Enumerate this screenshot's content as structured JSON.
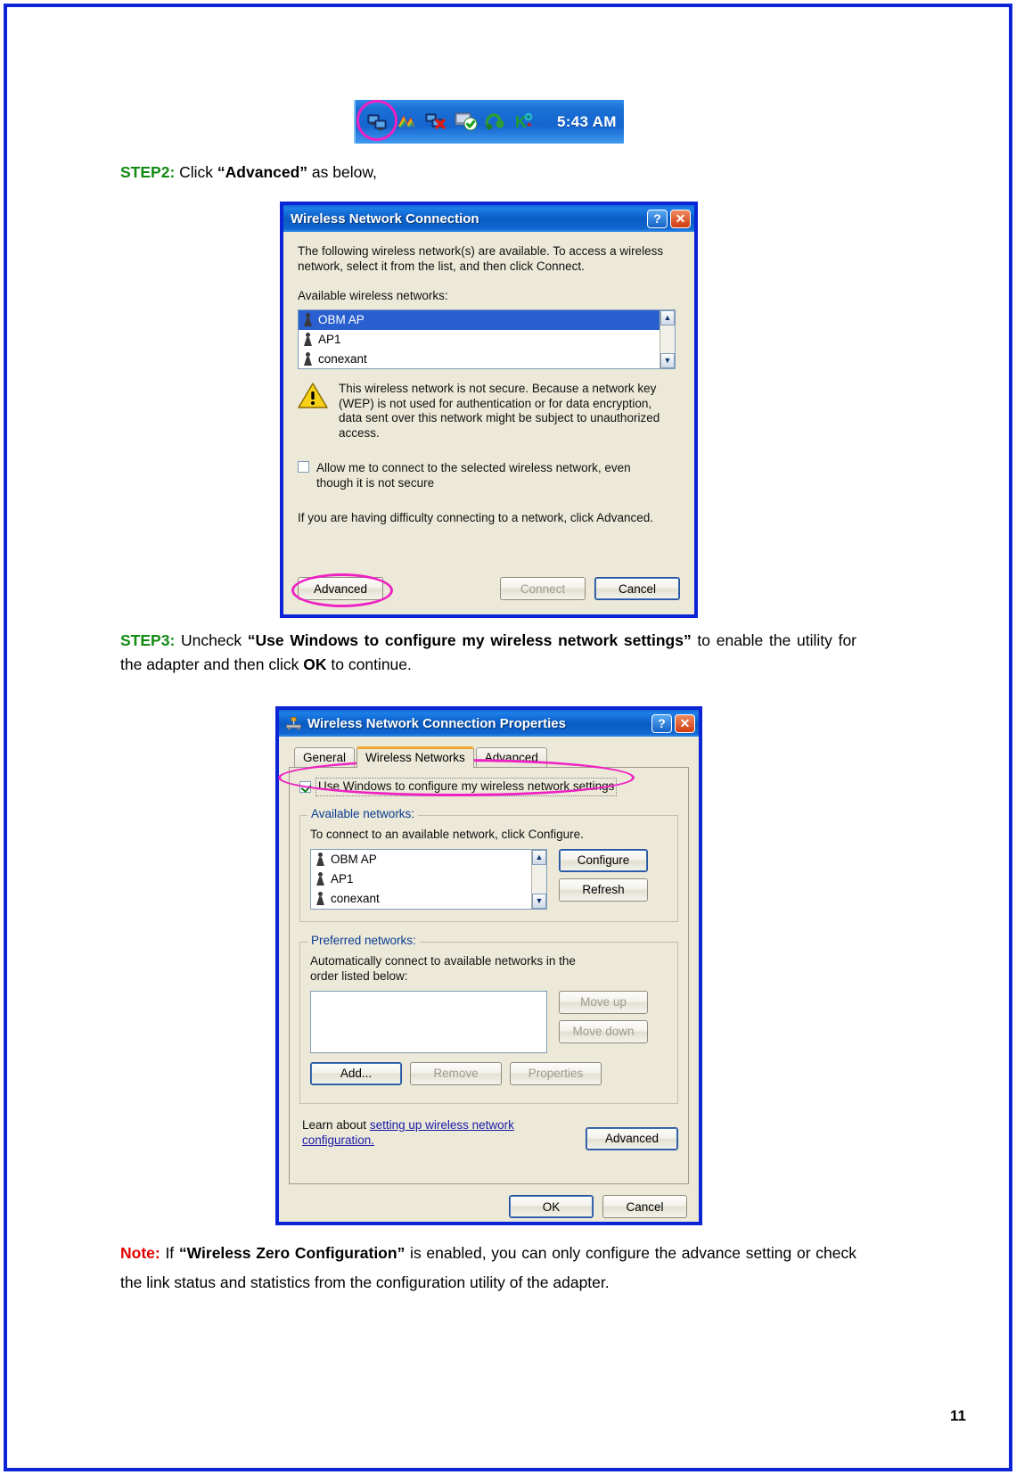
{
  "document": {
    "page_number": "11",
    "step2": {
      "label": "STEP2:",
      "text_before": " Click ",
      "bold": "“Advanced”",
      "text_after": " as below,"
    },
    "step3": {
      "label": "STEP3:",
      "text_before": " Uncheck ",
      "bold1": "“Use Windows to configure my wireless network settings”",
      "text_mid": " to enable the utility for the adapter and then click ",
      "bold2": "OK",
      "text_after": " to continue."
    },
    "note": {
      "label": "Note:",
      "text_before": " If ",
      "bold": "“Wireless Zero Configuration”",
      "text_after": " is enabled, you can only configure the advance setting or check the link status and statistics from the configuration utility of the adapter."
    }
  },
  "systray": {
    "time": "5:43 AM",
    "icons": [
      "wireless-network-icon",
      "volume-icon",
      "network-disconnected-icon",
      "antivirus-shield-icon",
      "usb-device-icon",
      "kaspersky-icon"
    ],
    "highlighted_icon": "wireless-network-icon"
  },
  "dialog1": {
    "title": "Wireless Network Connection",
    "help_button": "?",
    "close_button": "✕",
    "intro": "The following wireless network(s) are available. To access a wireless network, select it from the list, and then click Connect.",
    "available_label": "Available wireless networks:",
    "networks": [
      {
        "name": "OBM AP",
        "selected": true
      },
      {
        "name": "AP1",
        "selected": false
      },
      {
        "name": "conexant",
        "selected": false
      }
    ],
    "scroll_up": "▲",
    "scroll_down": "▼",
    "warning": "This wireless network is not secure. Because a network key (WEP) is not used for authentication or for data encryption, data sent over this network might be subject to unauthorized access.",
    "checkbox_label": "Allow me to connect to the selected wireless network, even though it is not secure",
    "checkbox_checked": false,
    "hint": "If you are having difficulty connecting to a network, click Advanced.",
    "buttons": {
      "advanced": "Advanced",
      "connect": "Connect",
      "cancel": "Cancel"
    },
    "highlighted_control": "advanced-button"
  },
  "dialog2": {
    "title": "Wireless Network Connection Properties",
    "help_button": "?",
    "close_button": "✕",
    "tabs": [
      {
        "label": "General",
        "active": false
      },
      {
        "label": "Wireless Networks",
        "active": true
      },
      {
        "label": "Advanced",
        "active": false
      }
    ],
    "use_windows_checkbox": {
      "label": "Use Windows to configure my wireless network settings",
      "checked": true,
      "highlighted": true
    },
    "available_networks": {
      "legend": "Available networks:",
      "instruction": "To connect to an available network, click Configure.",
      "networks": [
        {
          "name": "OBM AP"
        },
        {
          "name": "AP1"
        },
        {
          "name": "conexant"
        }
      ],
      "scroll_up": "▲",
      "scroll_down": "▼",
      "configure_button": "Configure",
      "refresh_button": "Refresh"
    },
    "preferred_networks": {
      "legend": "Preferred networks:",
      "instruction": "Automatically connect to available networks in the order listed below:",
      "items": [],
      "move_up_button": "Move up",
      "move_down_button": "Move down",
      "add_button": "Add...",
      "remove_button": "Remove",
      "properties_button": "Properties"
    },
    "learn_more": {
      "prefix": "Learn about ",
      "link": "setting up wireless network configuration."
    },
    "advanced_button": "Advanced",
    "ok_button": "OK",
    "cancel_button": "Cancel"
  },
  "colors": {
    "step_green": "#128a12",
    "note_red": "#e50000",
    "highlight_magenta": "#ee22c3",
    "page_border_blue": "#0b24d6",
    "xp_dialog_face": "#ece9d8",
    "xp_title_blue": "#0a5bc4",
    "selection_blue": "#2a5fd0"
  }
}
